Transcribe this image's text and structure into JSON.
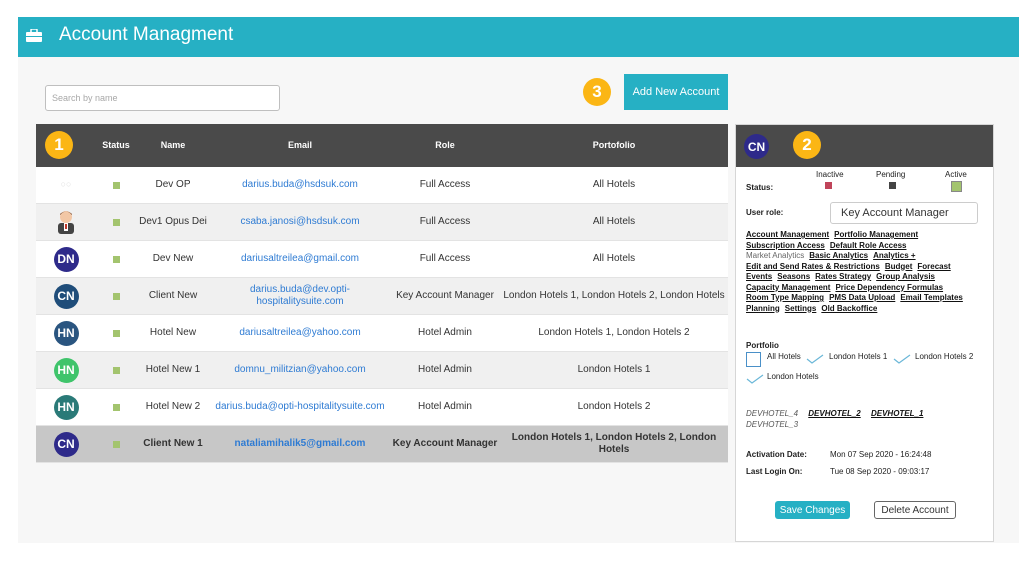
{
  "app": {
    "title": "Account Managment"
  },
  "search": {
    "placeholder": "Search by name"
  },
  "add_button": {
    "label": "Add New Account"
  },
  "badges": {
    "one": "1",
    "two": "2",
    "three": "3"
  },
  "table": {
    "columns": [
      "Status",
      "Name",
      "Email",
      "Role",
      "Portofolio"
    ],
    "rows": [
      {
        "avatar": "",
        "avatar_color": "",
        "name": "Dev OP",
        "email": "darius.buda@hsdsuk.com",
        "role": "Full Access",
        "portfolio": "All Hotels"
      },
      {
        "avatar": "person",
        "avatar_color": "",
        "name": "Dev1 Opus Dei",
        "email": "csaba.janosi@hsdsuk.com",
        "role": "Full Access",
        "portfolio": "All Hotels"
      },
      {
        "avatar": "DN",
        "avatar_color": "#2e2a8a",
        "name": "Dev New",
        "email": "dariusaltreilea@gmail.com",
        "role": "Full Access",
        "portfolio": "All Hotels"
      },
      {
        "avatar": "CN",
        "avatar_color": "#1f4d7a",
        "name": "Client New",
        "email": "darius.buda@dev.opti-hospitalitysuite.com",
        "role": "Key Account Manager",
        "portfolio": "London Hotels 1, London Hotels 2, London Hotels"
      },
      {
        "avatar": "HN",
        "avatar_color": "#2a5580",
        "name": "Hotel New",
        "email": "dariusaltreilea@yahoo.com",
        "role": "Hotel Admin",
        "portfolio": "London Hotels 1, London Hotels 2"
      },
      {
        "avatar": "HN",
        "avatar_color": "#3fc46b",
        "name": "Hotel New 1",
        "email": "domnu_militzian@yahoo.com",
        "role": "Hotel Admin",
        "portfolio": "London Hotels 1"
      },
      {
        "avatar": "HN",
        "avatar_color": "#2a7a78",
        "name": "Hotel New 2",
        "email": "darius.buda@opti-hospitalitysuite.com",
        "role": "Hotel Admin",
        "portfolio": "London Hotels 2"
      },
      {
        "avatar": "CN",
        "avatar_color": "#2e2a8a",
        "name": "Client New 1",
        "email": "nataliamihalik5@gmail.com",
        "role": "Key Account Manager",
        "portfolio": "London Hotels 1, London Hotels 2, London Hotels"
      }
    ]
  },
  "panel": {
    "avatar": "CN",
    "status_label": "Status:",
    "status_options": [
      "Inactive",
      "Pending",
      "Active"
    ],
    "user_role_label": "User role:",
    "user_role_value": "Key Account Manager",
    "permissions": [
      [
        "Account Management",
        "Portfolio Management"
      ],
      [
        "Subscription Access",
        "Default Role Access"
      ],
      [
        "Market Analytics",
        "Basic Analytics",
        "Analytics +"
      ],
      [
        "Edit and Send Rates & Restrictions",
        "Budget",
        "Forecast"
      ],
      [
        "Events",
        "Seasons",
        "Rates Strategy",
        "Group Analysis"
      ],
      [
        "Capacity Management",
        "Price Dependency Formulas"
      ],
      [
        "Room Type Mapping",
        "PMS Data Upload",
        "Email Templates"
      ],
      [
        "Planning",
        "Settings",
        "Old Backoffice"
      ]
    ],
    "portfolio_label": "Portfolio",
    "portfolio_options": [
      "All Hotels",
      "London Hotels 1",
      "London Hotels 2",
      "London Hotels"
    ],
    "hotels": [
      "DEVHOTEL_4",
      "DEVHOTEL_2",
      "DEVHOTEL_1",
      "DEVHOTEL_3"
    ],
    "activation_label": "Activation Date:",
    "activation_value": "Mon 07 Sep 2020 - 16:24:48",
    "last_login_label": "Last Login On:",
    "last_login_value": "Tue 08 Sep 2020 - 09:03:17",
    "save_label": "Save Changes",
    "delete_label": "Delete Account"
  },
  "colors": {
    "accent": "#26b0c4",
    "badge": "#fbb615",
    "header": "#4a4a4a",
    "status_active": "#a3c46e",
    "status_inactive": "#c0445a",
    "status_pending": "#444444"
  }
}
